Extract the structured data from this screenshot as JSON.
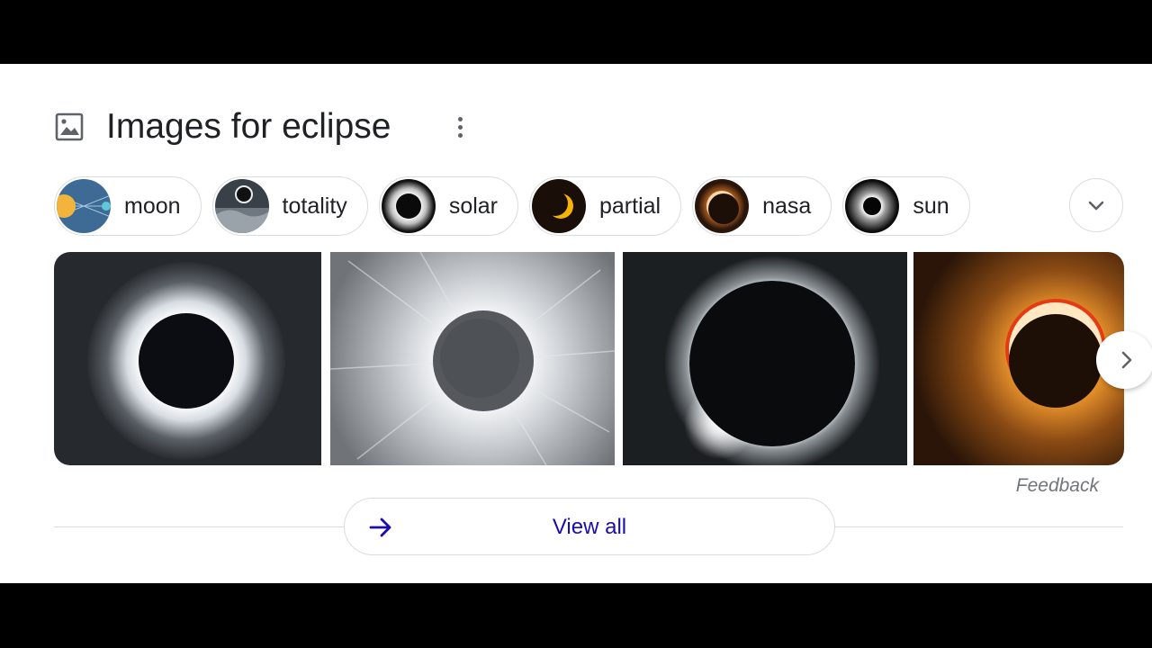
{
  "header": {
    "title": "Images for eclipse",
    "icon": "image-icon",
    "more_icon": "more-vertical-icon"
  },
  "chips": [
    {
      "label": "moon"
    },
    {
      "label": "totality"
    },
    {
      "label": "solar"
    },
    {
      "label": "partial"
    },
    {
      "label": "nasa"
    },
    {
      "label": "sun"
    }
  ],
  "expand_icon": "chevron-down-icon",
  "next_icon": "chevron-right-icon",
  "feedback": "Feedback",
  "view_all": {
    "label": "View all",
    "icon": "arrow-right-icon"
  },
  "colors": {
    "link": "#1a0dab",
    "text": "#202124",
    "border": "#dadce0",
    "muted": "#70757a"
  }
}
